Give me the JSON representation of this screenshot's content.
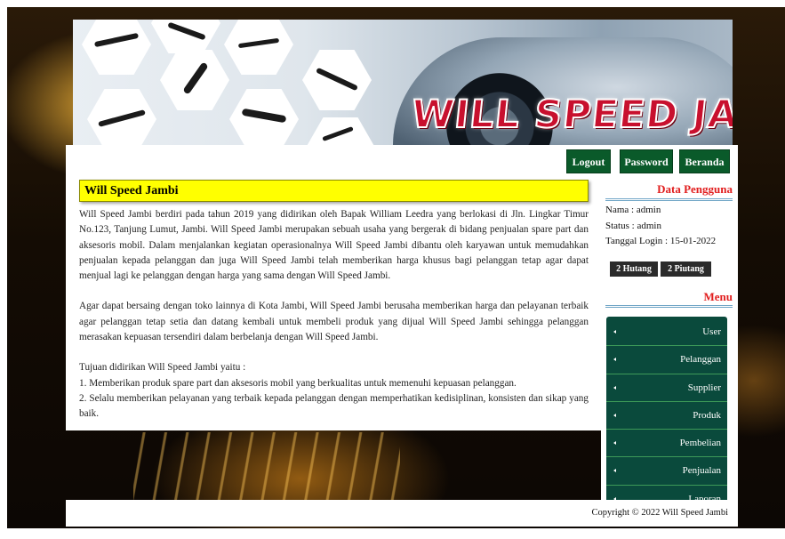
{
  "banner": {
    "logo_text": "WILL SPEED JAMBI"
  },
  "nav": {
    "logout": "Logout",
    "password": "Password",
    "beranda": "Beranda"
  },
  "content": {
    "title": "Will Speed Jambi",
    "paragraph1": "Will Speed Jambi berdiri pada tahun 2019 yang didirikan oleh Bapak William Leedra yang berlokasi di Jln. Lingkar Timur No.123, Tanjung Lumut, Jambi. Will Speed Jambi merupakan sebuah usaha yang bergerak di bidang penjualan spare part dan aksesoris mobil. Dalam menjalankan kegiatan operasionalnya Will Speed Jambi dibantu oleh karyawan untuk memudahkan penjualan kepada pelanggan dan juga Will Speed Jambi telah memberikan harga khusus bagi pelanggan tetap agar dapat menjual lagi ke pelanggan dengan harga yang sama dengan Will Speed Jambi.",
    "paragraph2": "Agar dapat bersaing dengan toko lainnya di Kota Jambi, Will Speed Jambi berusaha memberikan harga dan pelayanan terbaik agar pelanggan tetap setia dan datang kembali untuk membeli produk yang dijual Will Speed Jambi sehingga pelanggan merasakan kepuasan tersendiri dalam berbelanja dengan Will Speed Jambi.",
    "goals_intro": "Tujuan didirikan Will Speed Jambi yaitu :",
    "goal1": "1. Memberikan produk spare part dan aksesoris mobil yang berkualitas untuk memenuhi kepuasan pelanggan.",
    "goal2": "2. Selalu memberikan pelayanan yang terbaik kepada pelanggan dengan memperhatikan kedisiplinan, konsisten dan sikap yang baik."
  },
  "sidebar": {
    "user_heading": "Data Pengguna",
    "nama": "Nama : admin",
    "status": "Status : admin",
    "tanggal_login": "Tanggal Login : 15-01-2022",
    "hutang_badge": "2 Hutang",
    "piutang_badge": "2 Piutang",
    "menu_heading": "Menu",
    "menu_items": [
      {
        "label": "User"
      },
      {
        "label": "Pelanggan"
      },
      {
        "label": "Supplier"
      },
      {
        "label": "Produk"
      },
      {
        "label": "Pembelian"
      },
      {
        "label": "Penjualan"
      },
      {
        "label": "Laporan"
      }
    ]
  },
  "footer": {
    "copyright": "Copyright © 2022 Will Speed Jambi"
  },
  "colors": {
    "nav_button": "#0a5a2a",
    "menu_bg": "#0a4a3c",
    "title_bar": "#ffff00",
    "heading_red": "#e11d1d"
  }
}
